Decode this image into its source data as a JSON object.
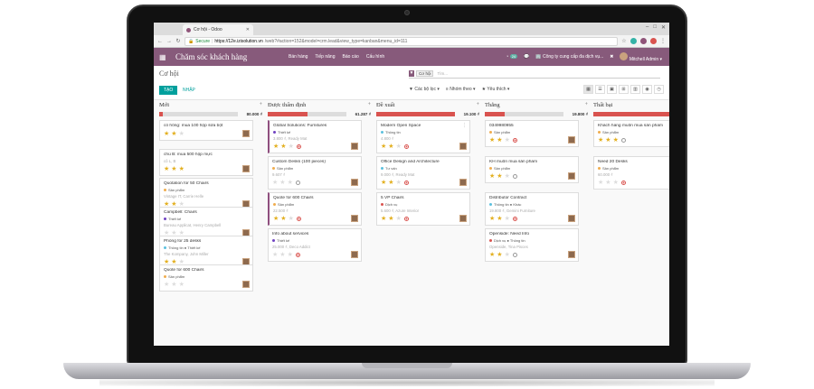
{
  "browser": {
    "tab_title": "Cơ hội - Odoo",
    "secure_label": "Secure",
    "url_host": "https://12e.izisolution.vn",
    "url_path": "/web?#action=152&model=crm.lead&view_type=kanban&menu_id=111"
  },
  "topnav": {
    "brand": "Chăm sóc khách hàng",
    "menu": [
      "Bán hàng",
      "Tiếp nâng",
      "Báo cáo",
      "Cấu hình"
    ],
    "chat_count": "24",
    "company": "Công ty cung cấp đa dịch vụ...",
    "user": "Mitchell Admin"
  },
  "control": {
    "breadcrumb": "Cơ hội",
    "facet": "Cơ hội",
    "search_placeholder": "Tìm...",
    "tag_label": "TẠO",
    "import_label": "NHẬP",
    "filters": [
      "Các bộ lọc",
      "Nhóm theo",
      "Yêu thích"
    ]
  },
  "columns": [
    {
      "name": "Mới",
      "total": "80.000 ₫",
      "progress": 0.05,
      "cards": [
        {
          "title": "cô hồng: mua 100 hộp sữa bột",
          "tag": "",
          "tag_color": "",
          "sub": "",
          "stars": 2,
          "circle": "",
          "accent": false
        },
        {
          "title": "chú B: mua 500 hộp mực",
          "tag": "",
          "tag_color": "",
          "sub": "cô L, B",
          "stars": 3,
          "circle": "",
          "accent": false
        },
        {
          "title": "Quotation for 50 Chairs",
          "tag": "Sản phẩm",
          "tag_color": "#f0ad4e",
          "sub": "Vintage IT, Carrie Helle",
          "stars": 2,
          "circle": "",
          "accent": false
        },
        {
          "title": "Campbell: Chairs",
          "tag": "Thiết kế",
          "tag_color": "#6f42c1",
          "sub": "Bureau Applicat, Henry Campbell",
          "stars": 0,
          "circle": "",
          "accent": false
        },
        {
          "title": "Phòng for 25 desks",
          "tag": "Thông tin ● Thiết kế",
          "tag_color": "#5bc0de",
          "sub": "The Kompany, John Miller",
          "stars": 2,
          "circle": "",
          "accent": false
        },
        {
          "title": "Quote for 600 Chairs",
          "tag": "Sản phẩm",
          "tag_color": "#f0ad4e",
          "sub": "",
          "stars": 0,
          "circle": "",
          "accent": false
        }
      ]
    },
    {
      "name": "Được thẩm định",
      "total": "61.287 ₫",
      "progress": 0.5,
      "cards": [
        {
          "title": "Global Solutions: Furnitures",
          "tag": "Thiết kế",
          "tag_color": "#6f42c1",
          "sub": "3.800 ₫, Ready Mat",
          "stars": 2,
          "circle": "red",
          "accent": true
        },
        {
          "title": "Custom Desks (100 pieces)",
          "tag": "Sản phẩm",
          "tag_color": "#f0ad4e",
          "sub": "9.607 ₫",
          "stars": 0,
          "circle": "grey",
          "accent": false
        },
        {
          "title": "Quote for 600 Chairs",
          "tag": "Sản phẩm",
          "tag_color": "#f0ad4e",
          "sub": "22.500 ₫",
          "stars": 2,
          "circle": "red",
          "accent": true
        },
        {
          "title": "Info about services",
          "tag": "Thiết kế",
          "tag_color": "#6f42c1",
          "sub": "25.000 ₫, Deco Addict",
          "stars": 0,
          "circle": "red",
          "accent": false
        }
      ]
    },
    {
      "name": "Đề xuất",
      "total": "19.100 ₫",
      "progress": 1.0,
      "cards": [
        {
          "title": "Modern Open Space",
          "tag": "Thông tin",
          "tag_color": "#5bc0de",
          "sub": "4.800 ₫",
          "stars": 2,
          "circle": "red",
          "accent": false
        },
        {
          "title": "Office Design and Architecture",
          "tag": "Tư vấn",
          "tag_color": "#5bc0de",
          "sub": "9.000 ₫, Ready Mat",
          "stars": 2,
          "circle": "red",
          "accent": false
        },
        {
          "title": "5 VP Chairs",
          "tag": "Dịch vụ",
          "tag_color": "#d9534f",
          "sub": "5.600 ₫, Azure Interior",
          "stars": 2,
          "circle": "red",
          "accent": false
        }
      ]
    },
    {
      "name": "Thắng",
      "total": "19.800 ₫",
      "progress": 0.25,
      "cards": [
        {
          "title": "0349980955",
          "tag": "Sản phẩm",
          "tag_color": "#f0ad4e",
          "sub": "",
          "stars": 2,
          "circle": "red",
          "accent": false
        },
        {
          "title": "KH muốn mua sản phẩm",
          "tag": "Sản phẩm",
          "tag_color": "#f0ad4e",
          "sub": "",
          "stars": 2,
          "circle": "grey",
          "accent": false
        },
        {
          "title": "Distributor Contract",
          "tag": "Thông tin ● Khác",
          "tag_color": "#5bc0de",
          "sub": "19.800 ₫, Gemini Furniture",
          "stars": 2,
          "circle": "red",
          "accent": false
        },
        {
          "title": "Openside: Need Info",
          "tag": "Dịch vụ ● Thông tin",
          "tag_color": "#d9534f",
          "sub": "Openside, Tina Pisces",
          "stars": 2,
          "circle": "grey",
          "accent": false
        }
      ]
    },
    {
      "name": "Thất bại",
      "total": "",
      "progress": 1.0,
      "cards": [
        {
          "title": "Khách hàng muốn mua sản phẩm",
          "tag": "Sản phẩm",
          "tag_color": "#f0ad4e",
          "sub": "",
          "stars": 3,
          "circle": "grey",
          "accent": false
        },
        {
          "title": "Need 20 Desks",
          "tag": "Sản phẩm",
          "tag_color": "#f0ad4e",
          "sub": "60.000 ₫",
          "stars": 0,
          "circle": "red",
          "accent": false
        }
      ]
    }
  ],
  "colors": {
    "brand": "#875a7b",
    "teal": "#00a09d",
    "star": "#e3b021",
    "danger": "#d9534f"
  }
}
